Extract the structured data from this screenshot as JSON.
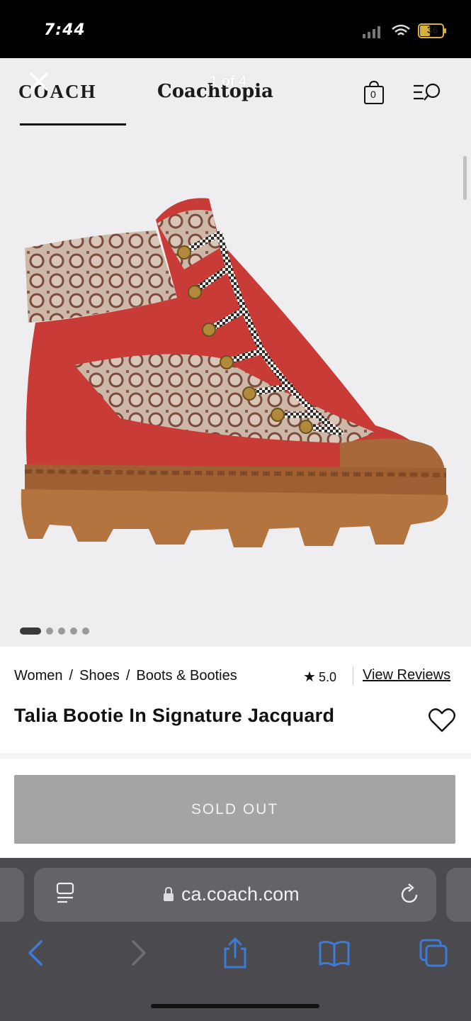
{
  "status_bar": {
    "time": "7:44",
    "battery": "36"
  },
  "header": {
    "brand": "COACH",
    "sub_brand": "Coachtopia",
    "image_counter": "1 of 4",
    "bag_count": "0"
  },
  "carousel": {
    "total_dots": 5,
    "active_index": 0
  },
  "breadcrumb": [
    "Women",
    "Shoes",
    "Boots & Booties"
  ],
  "breadcrumb_separator": "/",
  "rating": {
    "value": "5.0",
    "reviews_link": "View Reviews"
  },
  "product": {
    "title": "Talia Bootie In Signature Jacquard"
  },
  "cta": {
    "label": "SOLD OUT"
  },
  "browser": {
    "url": "ca.coach.com"
  },
  "colors": {
    "accent_blue": "#3d7bd9",
    "boot_red": "#c93b36",
    "sole_brown": "#a8693a"
  }
}
